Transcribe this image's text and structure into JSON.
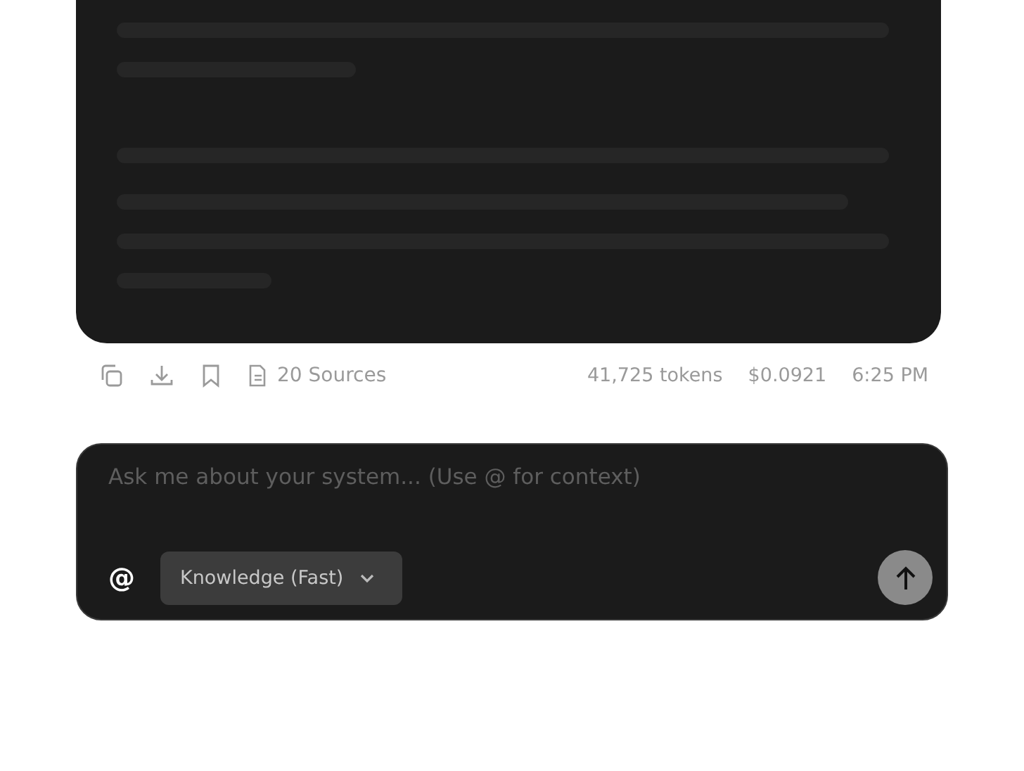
{
  "message_actions": {
    "sources": "20 Sources",
    "tokens": "41,725 tokens",
    "cost": "$0.0921",
    "time": "6:25 PM"
  },
  "composer": {
    "placeholder": "Ask me about your system... (Use @ for context)",
    "mention": "@",
    "mode": "Knowledge (Fast)"
  }
}
